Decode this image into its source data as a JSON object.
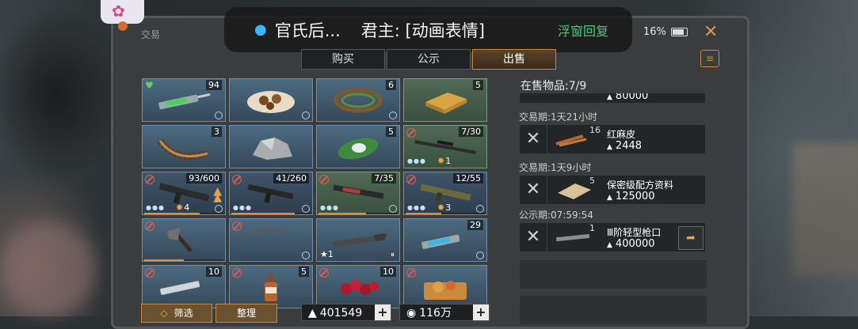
{
  "window": {
    "title": "交易",
    "battery": "16%"
  },
  "notification": {
    "sender": "官氏后...",
    "message": "君主: [动画表情]",
    "action": "浮窗回复"
  },
  "tabs": [
    {
      "label": "购买",
      "active": false
    },
    {
      "label": "公示",
      "active": false
    },
    {
      "label": "出售",
      "active": true
    }
  ],
  "inventory": [
    {
      "name": "heal-syringe",
      "count": "94",
      "style": "normal"
    },
    {
      "name": "food-plate",
      "count": "",
      "style": "normal"
    },
    {
      "name": "vine-bundle",
      "count": "6",
      "style": "normal"
    },
    {
      "name": "wood-plank",
      "count": "5",
      "style": "green"
    },
    {
      "name": "centipede",
      "count": "3",
      "style": "normal"
    },
    {
      "name": "stone-ore",
      "count": "",
      "style": "normal"
    },
    {
      "name": "leaf-item",
      "count": "5",
      "style": "normal"
    },
    {
      "name": "sniper-rifle",
      "count": "7/30",
      "style": "green",
      "level": "1"
    },
    {
      "name": "assault-rifle",
      "count": "93/600",
      "style": "normal",
      "level": "4"
    },
    {
      "name": "smg",
      "count": "41/260",
      "style": "normal",
      "level": ""
    },
    {
      "name": "red-rifle",
      "count": "7/35",
      "style": "green",
      "level": ""
    },
    {
      "name": "camo-rifle",
      "count": "12/55",
      "style": "normal",
      "level": "3"
    },
    {
      "name": "axe",
      "count": "",
      "style": "normal"
    },
    {
      "name": "pickaxe",
      "count": "",
      "style": "normal"
    },
    {
      "name": "shotgun",
      "count": "",
      "style": "normal",
      "star": "1"
    },
    {
      "name": "blue-syringe",
      "count": "29",
      "style": "normal"
    },
    {
      "name": "syringe",
      "count": "10",
      "style": "normal"
    },
    {
      "name": "bottle",
      "count": "5",
      "style": "normal"
    },
    {
      "name": "berries",
      "count": "10",
      "style": "normal"
    },
    {
      "name": "food-tray",
      "count": "",
      "style": "normal"
    }
  ],
  "bottom": {
    "filter_label": "筛选",
    "sort_label": "整理",
    "currency1": "401549",
    "currency2": "116万"
  },
  "on_sale": {
    "label": "在售物品:7/9"
  },
  "listings": [
    {
      "period": "",
      "name": "",
      "qty": "",
      "price": "80000"
    },
    {
      "period": "交易期:1天21小时",
      "name": "红麻皮",
      "qty": "16",
      "price": "2448"
    },
    {
      "period": "交易期:1天9小时",
      "name": "保密级配方资料",
      "qty": "5",
      "price": "125000"
    },
    {
      "period": "公示期:07:59:54",
      "name": "Ⅲ阶轻型枪口",
      "qty": "1",
      "price": "400000"
    }
  ],
  "colors": {
    "accent": "#c28a43",
    "ban": "#e15a4f",
    "notif_action": "#37d27b"
  }
}
